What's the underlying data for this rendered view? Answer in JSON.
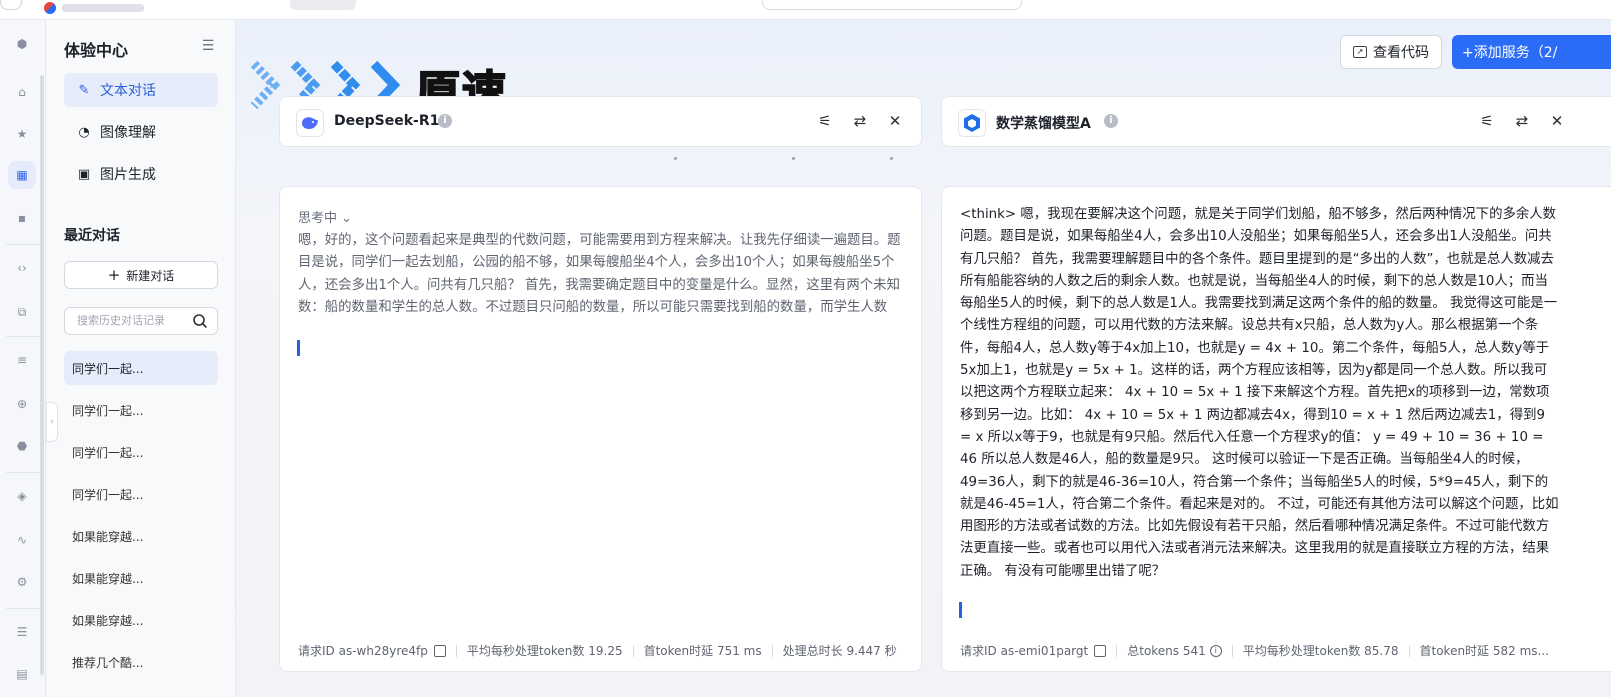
{
  "sidebar": {
    "title": "体验中心",
    "nav": [
      {
        "label": "文本对话",
        "icon": "chat-edit-icon",
        "active": true
      },
      {
        "label": "图像理解",
        "icon": "image-understand-icon",
        "active": false
      },
      {
        "label": "图片生成",
        "icon": "image-generate-icon",
        "active": false
      }
    ],
    "recent_title": "最近对话",
    "new_chat_label": "新建对话",
    "search_placeholder": "搜索历史对话记录",
    "history": [
      "同学们一起...",
      "同学们一起...",
      "同学们一起...",
      "同学们一起...",
      "如果能穿越...",
      "如果能穿越...",
      "如果能穿越...",
      "推荐几个酷..."
    ]
  },
  "header": {
    "speed_label": "原速",
    "view_code_label": "查看代码",
    "add_service_label": "+添加服务（2/"
  },
  "left_panel": {
    "model_name": "DeepSeek-R1",
    "thinking_label": "思考中",
    "reply_text": "嗯，好的，这个问题看起来是典型的代数问题，可能需要用到方程来解决。让我先仔细读一遍题目。题目是说，同学们一起去划船，公园的船不够，如果每艘船坐4个人，会多出10个人；如果每艘船坐5个人，还会多出1个人。问共有几只船？ 首先，我需要确定题目中的变量是什么。显然，这里有两个未知数：船的数量和学生的总人数。不过题目只问船的数量，所以可能只需要找到船的数量，而学生人数",
    "stats": {
      "request_id": "请求ID as-wh28yre4fp",
      "avg_speed": "平均每秒处理token数 19.25",
      "first_token": "首token时延 751 ms",
      "total_time": "处理总时长 9.447 秒"
    }
  },
  "right_panel": {
    "model_name": "数学蒸馏模型A",
    "reply_text": "<think> 嗯，我现在要解决这个问题，就是关于同学们划船，船不够多，然后两种情况下的多余人数问题。题目是说，如果每船坐4人，会多出10人没船坐；如果每船坐5人，还会多出1人没船坐。问共有几只船？ 首先，我需要理解题目中的各个条件。题目里提到的是“多出的人数”，也就是总人数减去所有船能容纳的人数之后的剩余人数。也就是说，当每船坐4人的时候，剩下的总人数是10人；而当每船坐5人的时候，剩下的总人数是1人。我需要找到满足这两个条件的船的数量。 我觉得这可能是一个线性方程组的问题，可以用代数的方法来解。设总共有x只船，总人数为y人。那么根据第一个条件，每船4人，总人数y等于4x加上10，也就是y = 4x + 10。第二个条件，每船5人，总人数y等于5x加上1，也就是y = 5x + 1。这样的话，两个方程应该相等，因为y都是同一个总人数。所以我可以把这两个方程联立起来： 4x + 10 = 5x + 1 接下来解这个方程。首先把x的项移到一边，常数项移到另一边。比如： 4x + 10 = 5x + 1 两边都减去4x，得到10 = x + 1 然后两边减去1，得到9 = x 所以x等于9，也就是有9只船。然后代入任意一个方程求y的值： y = 49 + 10 = 36 + 10 = 46 所以总人数是46人，船的数量是9只。 这时候可以验证一下是否正确。当每船坐4人的时候，49=36人，剩下的就是46-36=10人，符合第一个条件；当每船坐5人的时候，5*9=45人，剩下的就是46-45=1人，符合第二个条件。看起来是对的。 不过，可能还有其他方法可以解这个问题，比如用图形的方法或者试数的方法。比如先假设有若干只船，然后看哪种情况满足条件。不过可能代数方法更直接一些。或者也可以用代入法或者消元法来解决。这里我用的就是直接联立方程的方法，结果正确。 有没有可能哪里出错了呢？",
    "stats": {
      "request_id": "请求ID as-emi01pargt",
      "total_tokens": "总tokens 541",
      "avg_speed": "平均每秒处理token数 85.78",
      "first_token": "首token时延 582 ms..."
    }
  },
  "colors": {
    "accent": "#2a6cf5",
    "active_bg": "#e7ecfb",
    "chevron": "#2f8df0"
  }
}
